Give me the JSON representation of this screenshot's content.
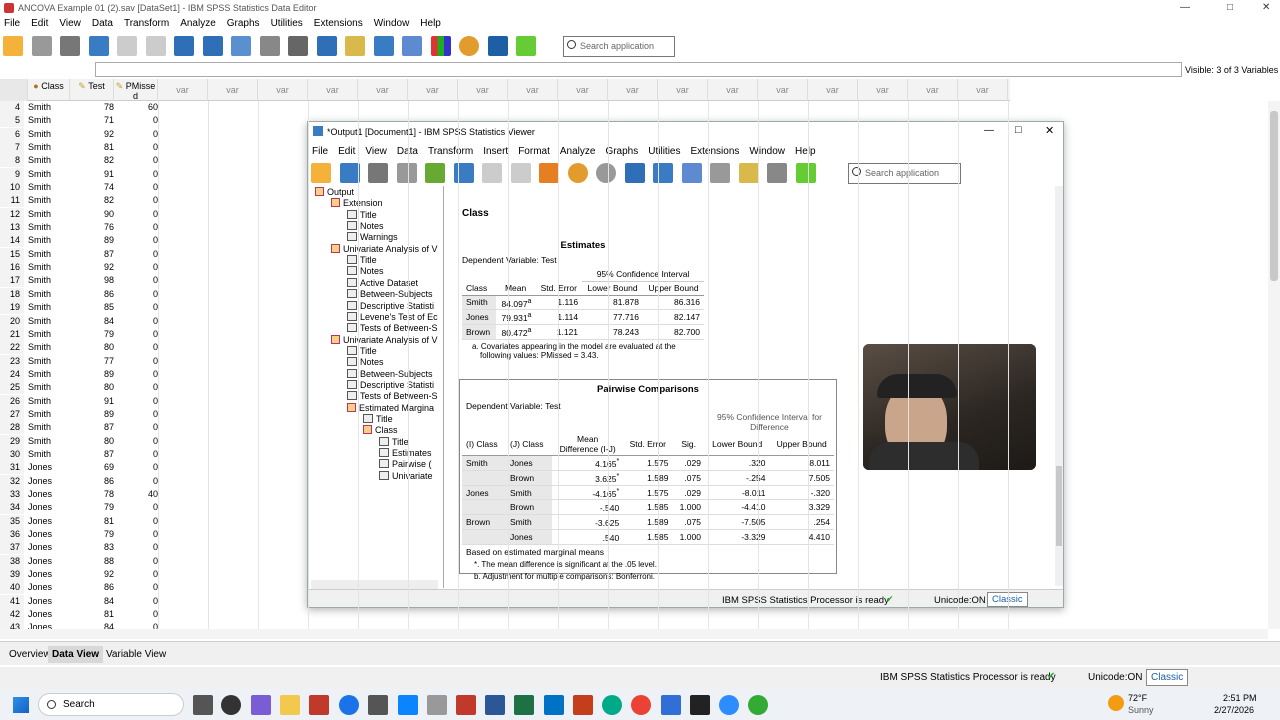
{
  "title": "ANCOVA Example 01 (2).sav [DataSet1] - IBM SPSS Statistics Data Editor",
  "menu": [
    "File",
    "Edit",
    "View",
    "Data",
    "Transform",
    "Analyze",
    "Graphs",
    "Utilities",
    "Extensions",
    "Window",
    "Help"
  ],
  "search_placeholder": "Search application",
  "visible": "Visible: 3 of 3 Variables",
  "columns": {
    "c1": "Class",
    "c2": "Test",
    "c3a": "PMisse",
    "c3b": "d",
    "var": "var"
  },
  "rows": [
    [
      "4",
      "Smith",
      "78",
      "60"
    ],
    [
      "5",
      "Smith",
      "71",
      "0"
    ],
    [
      "6",
      "Smith",
      "92",
      "0"
    ],
    [
      "7",
      "Smith",
      "81",
      "0"
    ],
    [
      "8",
      "Smith",
      "82",
      "0"
    ],
    [
      "9",
      "Smith",
      "91",
      "0"
    ],
    [
      "10",
      "Smith",
      "74",
      "0"
    ],
    [
      "11",
      "Smith",
      "82",
      "0"
    ],
    [
      "12",
      "Smith",
      "90",
      "0"
    ],
    [
      "13",
      "Smith",
      "76",
      "0"
    ],
    [
      "14",
      "Smith",
      "89",
      "0"
    ],
    [
      "15",
      "Smith",
      "87",
      "0"
    ],
    [
      "16",
      "Smith",
      "92",
      "0"
    ],
    [
      "17",
      "Smith",
      "98",
      "0"
    ],
    [
      "18",
      "Smith",
      "86",
      "0"
    ],
    [
      "19",
      "Smith",
      "85",
      "0"
    ],
    [
      "20",
      "Smith",
      "84",
      "0"
    ],
    [
      "21",
      "Smith",
      "79",
      "0"
    ],
    [
      "22",
      "Smith",
      "80",
      "0"
    ],
    [
      "23",
      "Smith",
      "77",
      "0"
    ],
    [
      "24",
      "Smith",
      "89",
      "0"
    ],
    [
      "25",
      "Smith",
      "80",
      "0"
    ],
    [
      "26",
      "Smith",
      "91",
      "0"
    ],
    [
      "27",
      "Smith",
      "89",
      "0"
    ],
    [
      "28",
      "Smith",
      "87",
      "0"
    ],
    [
      "29",
      "Smith",
      "80",
      "0"
    ],
    [
      "30",
      "Smith",
      "87",
      "0"
    ],
    [
      "31",
      "Jones",
      "69",
      "0"
    ],
    [
      "32",
      "Jones",
      "86",
      "0"
    ],
    [
      "33",
      "Jones",
      "78",
      "40"
    ],
    [
      "34",
      "Jones",
      "79",
      "0"
    ],
    [
      "35",
      "Jones",
      "81",
      "0"
    ],
    [
      "36",
      "Jones",
      "79",
      "0"
    ],
    [
      "37",
      "Jones",
      "83",
      "0"
    ],
    [
      "38",
      "Jones",
      "88",
      "0"
    ],
    [
      "39",
      "Jones",
      "92",
      "0"
    ],
    [
      "40",
      "Jones",
      "86",
      "0"
    ],
    [
      "41",
      "Jones",
      "84",
      "0"
    ],
    [
      "42",
      "Jones",
      "81",
      "0"
    ],
    [
      "43",
      "Jones",
      "84",
      "0"
    ]
  ],
  "tabs": {
    "overview": "Overview",
    "data": "Data View",
    "variable": "Variable View"
  },
  "status": {
    "text": "IBM SPSS Statistics Processor is ready",
    "unicode": "Unicode:ON",
    "classic": "Classic"
  },
  "taskbar": {
    "search": "Search",
    "weather_temp": "72°F",
    "weather": "Sunny",
    "time": "2:51 PM",
    "date": "2/27/2026"
  },
  "viewer": {
    "title": "*Output1 [Document1] - IBM SPSS Statistics Viewer",
    "menu": [
      "File",
      "Edit",
      "View",
      "Data",
      "Transform",
      "Insert",
      "Format",
      "Analyze",
      "Graphs",
      "Utilities",
      "Extensions",
      "Window",
      "Help"
    ],
    "tree": [
      "Output",
      "Extension",
      "Title",
      "Notes",
      "Warnings",
      "Univariate Analysis of V",
      "Title",
      "Notes",
      "Active Dataset",
      "Between-Subjects",
      "Descriptive Statisti",
      "Levene's Test of Ec",
      "Tests of Between-S",
      "Univariate Analysis of V",
      "Title",
      "Notes",
      "Between-Subjects",
      "Descriptive Statisti",
      "Tests of Between-S",
      "Estimated Margina",
      "Title",
      "Class",
      "Title",
      "Estimates",
      "Pairwise (",
      "Univariate"
    ],
    "class_heading": "Class",
    "est": {
      "title": "Estimates",
      "dep": "Dependent Variable:   Test",
      "ci": "95% Confidence Interval",
      "h": [
        "Class",
        "Mean",
        "Std. Error",
        "Lower Bound",
        "Upper Bound"
      ],
      "rows": [
        [
          "Smith",
          "84.097",
          "a",
          "1.116",
          "81.878",
          "86.316"
        ],
        [
          "Jones",
          "79.931",
          "a",
          "1.114",
          "77.716",
          "82.147"
        ],
        [
          "Brown",
          "80.472",
          "a",
          "1.121",
          "78.243",
          "82.700"
        ]
      ],
      "note1": "a. Covariates appearing in the model are evaluated at the",
      "note2": "following values: PMissed = 3.43."
    },
    "pw": {
      "title": "Pairwise Comparisons",
      "dep": "Dependent Variable:   Test",
      "ci1": "95% Confidence Interval for",
      "ci2": "Difference",
      "h": [
        "(I) Class",
        "(J) Class",
        "Mean",
        "Difference (I-J)",
        "Std. Error",
        "Sig.",
        "Lower Bound",
        "Upper Bound"
      ],
      "rows": [
        [
          "Smith",
          "Jones",
          "4.165",
          "*",
          "1.575",
          ".029",
          ".320",
          "8.011"
        ],
        [
          "",
          "Brown",
          "3.625",
          "*",
          "1.589",
          ".075",
          "-.254",
          "7.505"
        ],
        [
          "Jones",
          "Smith",
          "-4.165",
          "*",
          "1.575",
          ".029",
          "-8.011",
          "-.320"
        ],
        [
          "",
          "Brown",
          "-.540",
          "",
          "1.585",
          "1.000",
          "-4.410",
          "3.329"
        ],
        [
          "Brown",
          "Smith",
          "-3.625",
          "",
          "1.589",
          ".075",
          "-7.505",
          ".254"
        ],
        [
          "",
          "Jones",
          ".540",
          "",
          "1.585",
          "1.000",
          "-3.329",
          "4.410"
        ]
      ],
      "n1": "Based on estimated marginal means",
      "n2": "*. The mean difference is significant at the .05 level.",
      "n3": "b. Adjustment for multiple comparisons: Bonferroni."
    }
  }
}
